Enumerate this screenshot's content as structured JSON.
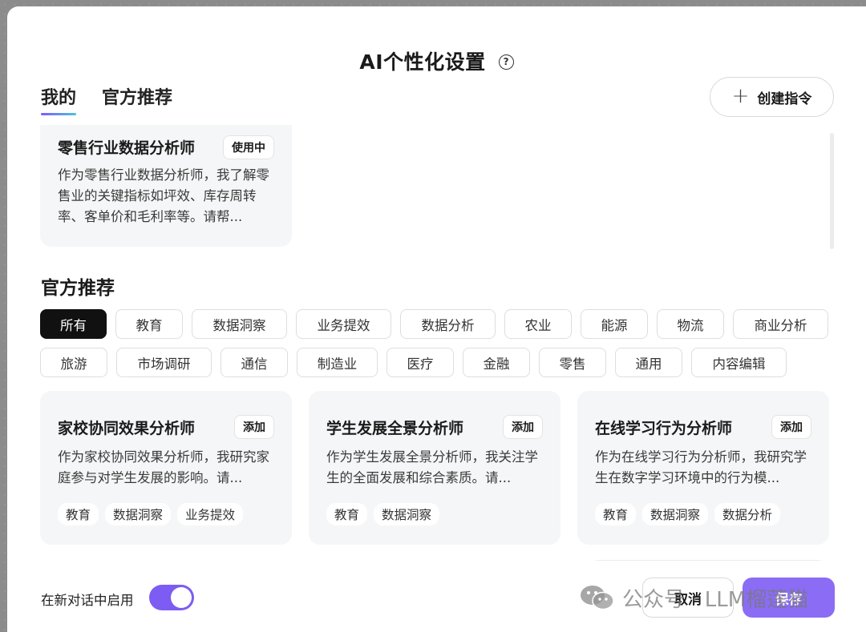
{
  "dialog": {
    "title": "AI个性化设置",
    "help_icon": "?"
  },
  "tabs": [
    {
      "label": "我的",
      "active": true
    },
    {
      "label": "官方推荐",
      "active": false
    }
  ],
  "create_button": {
    "icon": "+",
    "label": "创建指令"
  },
  "my_card": {
    "title": "零售行业数据分析师",
    "badge": "使用中",
    "desc": "作为零售行业数据分析师，我了解零售业的关键指标如坪效、库存周转率、客单价和毛利率等。请帮..."
  },
  "section_title": "官方推荐",
  "filters_row1": [
    "所有",
    "教育",
    "数据洞察",
    "业务提效",
    "数据分析",
    "农业",
    "能源",
    "物流",
    "商业分析"
  ],
  "filters_row2": [
    "旅游",
    "市场调研",
    "通信",
    "制造业",
    "医疗",
    "金融",
    "零售",
    "通用",
    "内容编辑"
  ],
  "active_filter": "所有",
  "rec_cards": [
    {
      "title": "家校协同效果分析师",
      "badge": "添加",
      "desc": "作为家校协同效果分析师，我研究家庭参与对学生发展的影响。请...",
      "tags": [
        "教育",
        "数据洞察",
        "业务提效"
      ]
    },
    {
      "title": "学生发展全景分析师",
      "badge": "添加",
      "desc": "作为学生发展全景分析师，我关注学生的全面发展和综合素质。请...",
      "tags": [
        "教育",
        "数据洞察"
      ]
    },
    {
      "title": "在线学习行为分析师",
      "badge": "添加",
      "desc": "作为在线学习行为分析师，我研究学生在数字学习环境中的行为模...",
      "tags": [
        "教育",
        "数据洞察",
        "数据分析"
      ]
    }
  ],
  "footer": {
    "toggle_label": "在新对话中启用",
    "toggle_on": true,
    "cancel_label": "取消",
    "save_label": "保存"
  },
  "watermark": {
    "text": "公众号 · LLM榴莲猫"
  },
  "colors": {
    "accent": "#7c5cf2",
    "active_chip": "#111111",
    "card_bg": "#f5f6f7"
  }
}
